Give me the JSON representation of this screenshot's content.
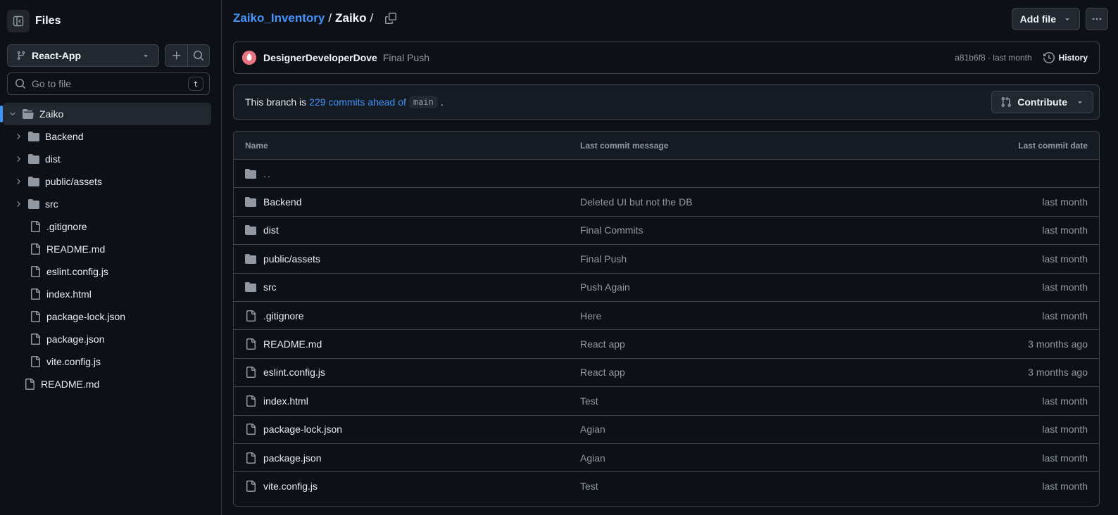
{
  "sidebar": {
    "title": "Files",
    "branch": "React-App",
    "search_placeholder": "Go to file",
    "search_shortcut": "t",
    "tree": [
      {
        "label": "Zaiko",
        "kind": "folder",
        "expanded": true,
        "active": true,
        "depth": 0
      },
      {
        "label": "Backend",
        "kind": "folder",
        "depth": 1
      },
      {
        "label": "dist",
        "kind": "folder",
        "depth": 1
      },
      {
        "label": "public/assets",
        "kind": "folder",
        "depth": 1
      },
      {
        "label": "src",
        "kind": "folder",
        "depth": 1
      },
      {
        "label": ".gitignore",
        "kind": "file",
        "depth": 1
      },
      {
        "label": "README.md",
        "kind": "file",
        "depth": 1
      },
      {
        "label": "eslint.config.js",
        "kind": "file",
        "depth": 1
      },
      {
        "label": "index.html",
        "kind": "file",
        "depth": 1
      },
      {
        "label": "package-lock.json",
        "kind": "file",
        "depth": 1
      },
      {
        "label": "package.json",
        "kind": "file",
        "depth": 1
      },
      {
        "label": "vite.config.js",
        "kind": "file",
        "depth": 1
      },
      {
        "label": "README.md",
        "kind": "file",
        "depth": 0
      }
    ]
  },
  "breadcrumb": {
    "repo": "Zaiko_Inventory",
    "sep1": "/",
    "dir": "Zaiko",
    "sep2": "/"
  },
  "actions": {
    "add_file": "Add file",
    "more": "···"
  },
  "commit": {
    "author": "DesignerDeveloperDove",
    "message": "Final Push",
    "sha_time": "a81b6f8 · last month",
    "history": "History"
  },
  "branch_status": {
    "prefix": "This branch is",
    "link": "229 commits ahead of",
    "base": "main",
    "suffix": ".",
    "contribute": "Contribute"
  },
  "table": {
    "headers": {
      "name": "Name",
      "message": "Last commit message",
      "date": "Last commit date"
    },
    "parent": "..",
    "rows": [
      {
        "name": "Backend",
        "kind": "folder",
        "message": "Deleted UI but not the DB",
        "date": "last month"
      },
      {
        "name": "dist",
        "kind": "folder",
        "message": "Final Commits",
        "date": "last month"
      },
      {
        "name": "public/assets",
        "kind": "folder",
        "message": "Final Push",
        "date": "last month"
      },
      {
        "name": "src",
        "kind": "folder",
        "message": "Push Again",
        "date": "last month"
      },
      {
        "name": ".gitignore",
        "kind": "file",
        "message": "Here",
        "date": "last month"
      },
      {
        "name": "README.md",
        "kind": "file",
        "message": "React app",
        "date": "3 months ago"
      },
      {
        "name": "eslint.config.js",
        "kind": "file",
        "message": "React app",
        "date": "3 months ago"
      },
      {
        "name": "index.html",
        "kind": "file",
        "message": "Test",
        "date": "last month"
      },
      {
        "name": "package-lock.json",
        "kind": "file",
        "message": "Agian",
        "date": "last month"
      },
      {
        "name": "package.json",
        "kind": "file",
        "message": "Agian",
        "date": "last month"
      },
      {
        "name": "vite.config.js",
        "kind": "file",
        "message": "Test",
        "date": "last month"
      }
    ]
  },
  "colors": {
    "background": "#0d1117",
    "accent_link": "#4493f8",
    "muted": "#9198a1",
    "border": "#3d444d"
  }
}
